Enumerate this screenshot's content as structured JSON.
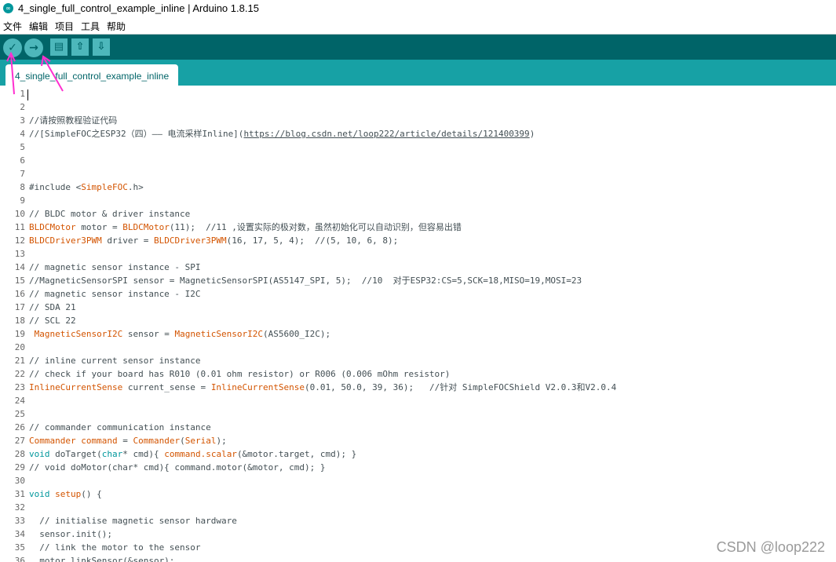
{
  "window": {
    "app_icon": "arduino-icon",
    "title": "4_single_full_control_example_inline | Arduino 1.8.15"
  },
  "menu": [
    "文件",
    "编辑",
    "项目",
    "工具",
    "帮助"
  ],
  "toolbar": {
    "verify_icon": "✓",
    "upload_icon": "→",
    "new_icon": "▤",
    "open_icon": "⇧",
    "save_icon": "⇩"
  },
  "tabs": [
    {
      "label": "4_single_full_control_example_inline"
    }
  ],
  "editor": {
    "line_numbers": [
      "1",
      "2",
      "3",
      "4",
      "5",
      "6",
      "7",
      "8",
      "9",
      "10",
      "11",
      "12",
      "13",
      "14",
      "15",
      "16",
      "17",
      "18",
      "19",
      "20",
      "21",
      "22",
      "23",
      "24",
      "25",
      "26",
      "27",
      "28",
      "29",
      "30",
      "31",
      "32",
      "33",
      "34",
      "35",
      "36"
    ],
    "lines": [
      "",
      "",
      "//请按照教程验证代码",
      "//[SimpleFOC之ESP32（四）—— 电流采样Inline](https://blog.csdn.net/loop222/article/details/121400399)",
      "",
      "",
      "",
      "#include <SimpleFOC.h>",
      "",
      "// BLDC motor & driver instance",
      "BLDCMotor motor = BLDCMotor(11);  //11 ,设置实际的极对数，虽然初始化可以自动识别，但容易出错",
      "BLDCDriver3PWM driver = BLDCDriver3PWM(16, 17, 5, 4);  //(5, 10, 6, 8);",
      "",
      "// magnetic sensor instance - SPI",
      "//MagneticSensorSPI sensor = MagneticSensorSPI(AS5147_SPI, 5);  //10  对于ESP32:CS=5,SCK=18,MISO=19,MOSI=23",
      "// magnetic sensor instance - I2C",
      "// SDA 21",
      "// SCL 22",
      " MagneticSensorI2C sensor = MagneticSensorI2C(AS5600_I2C);",
      "",
      "// inline current sensor instance",
      "// check if your board has R010 (0.01 ohm resistor) or R006 (0.006 mOhm resistor)",
      "InlineCurrentSense current_sense = InlineCurrentSense(0.01, 50.0, 39, 36);   //针对 SimpleFOCShield V2.0.3和V2.0.4",
      "",
      "",
      "// commander communication instance",
      "Commander command = Commander(Serial);",
      "void doTarget(char* cmd){ command.scalar(&motor.target, cmd); }",
      "// void doMotor(char* cmd){ command.motor(&motor, cmd); }",
      "",
      "void setup() {",
      "",
      "  // initialise magnetic sensor hardware",
      "  sensor.init();",
      "  // link the motor to the sensor",
      "  motor.linkSensor(&sensor);"
    ]
  },
  "watermark": "CSDN @loop222"
}
